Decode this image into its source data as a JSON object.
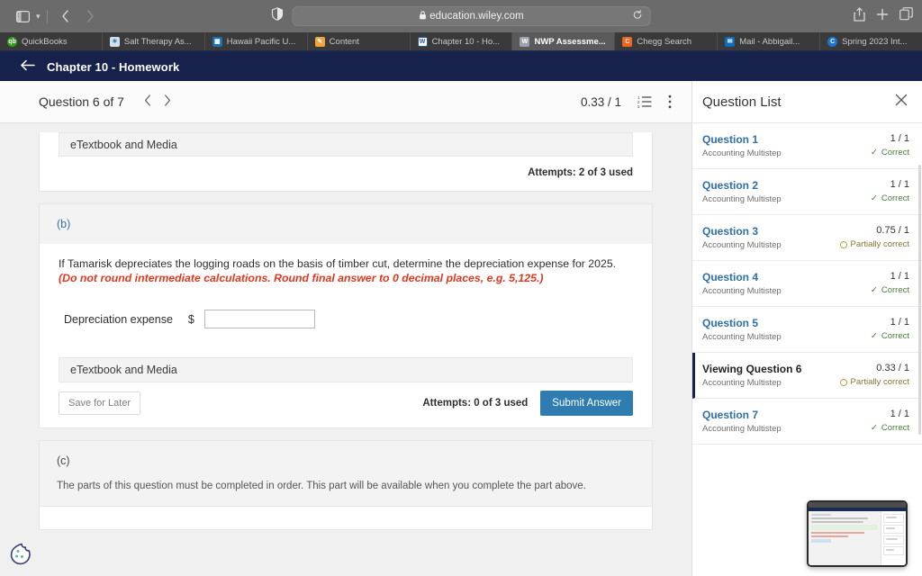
{
  "browser": {
    "url": "education.wiley.com",
    "lock_icon": "lock-icon",
    "reload_icon": "reload-icon",
    "shield_icon": "privacy-shield-icon",
    "sidebar_icon": "sidebar-toggle-icon",
    "back_icon": "back-arrow-icon",
    "forward_icon": "forward-arrow-icon",
    "share_icon": "share-icon",
    "newtab_icon": "plus-icon",
    "tabs_icon": "tab-overview-icon",
    "bookmarks": [
      {
        "label": "QuickBooks",
        "icon": "quickbooks-icon",
        "active": false
      },
      {
        "label": "Salt Therapy As...",
        "icon": "salt-therapy-icon",
        "active": false
      },
      {
        "label": "Hawaii Pacific U...",
        "icon": "hawaii-pacific-icon",
        "active": false
      },
      {
        "label": "Content",
        "icon": "content-icon",
        "active": false
      },
      {
        "label": "Chapter 10 - Ho...",
        "icon": "word-doc-icon",
        "active": false
      },
      {
        "label": "NWP Assessme...",
        "icon": "word-doc-icon",
        "active": true
      },
      {
        "label": "Chegg Search",
        "icon": "chegg-icon",
        "active": false
      },
      {
        "label": "Mail - Abbigail...",
        "icon": "outlook-icon",
        "active": false
      },
      {
        "label": "Spring 2023 Int...",
        "icon": "canvas-icon",
        "active": false
      }
    ]
  },
  "app": {
    "title": "Chapter 10 - Homework",
    "back_icon": "back-arrow-icon"
  },
  "question_header": {
    "position": "Question 6 of 7",
    "prev_icon": "chevron-left-icon",
    "next_icon": "chevron-right-icon",
    "score": "0.33 / 1",
    "list_icon": "numbered-list-icon",
    "menu_icon": "kebab-menu-icon"
  },
  "part_a": {
    "etextbook_label": "eTextbook and Media",
    "attempts": "Attempts: 2 of 3 used"
  },
  "part_b": {
    "label": "(b)",
    "question_text": "If Tamarisk depreciates the logging roads on the basis of timber cut, determine the depreciation expense for 2025.",
    "instruction_text": "(Do not round intermediate calculations. Round final answer to 0 decimal places, e.g. 5,125.)",
    "answer_label": "Depreciation expense",
    "currency_symbol": "$",
    "answer_value": "",
    "answer_placeholder": "",
    "etextbook_label": "eTextbook and Media",
    "save_for_later": "Save for Later",
    "attempts": "Attempts: 0 of 3 used",
    "submit_label": "Submit Answer",
    "submit_color": "#2e7cb0"
  },
  "part_c": {
    "label": "(c)",
    "text": "The parts of this question must be completed in order. This part will be available when you complete the part above."
  },
  "question_list": {
    "title": "Question List",
    "close_icon": "close-icon",
    "items": [
      {
        "name": "Question 1",
        "subtitle": "Accounting Multistep",
        "score": "1 / 1",
        "status": "Correct",
        "status_type": "correct",
        "current": false
      },
      {
        "name": "Question 2",
        "subtitle": "Accounting Multistep",
        "score": "1 / 1",
        "status": "Correct",
        "status_type": "correct",
        "current": false
      },
      {
        "name": "Question 3",
        "subtitle": "Accounting Multistep",
        "score": "0.75 / 1",
        "status": "Partially correct",
        "status_type": "partial",
        "current": false
      },
      {
        "name": "Question 4",
        "subtitle": "Accounting Multistep",
        "score": "1 / 1",
        "status": "Correct",
        "status_type": "correct",
        "current": false
      },
      {
        "name": "Question 5",
        "subtitle": "Accounting Multistep",
        "score": "1 / 1",
        "status": "Correct",
        "status_type": "correct",
        "current": false
      },
      {
        "name": "Viewing Question 6",
        "subtitle": "Accounting Multistep",
        "score": "0.33 / 1",
        "status": "Partially correct",
        "status_type": "partial",
        "current": true
      },
      {
        "name": "Question 7",
        "subtitle": "Accounting Multistep",
        "score": "1 / 1",
        "status": "Correct",
        "status_type": "correct",
        "current": false
      }
    ]
  },
  "overlays": {
    "cookie_icon": "cookie-consent-icon",
    "preview_thumbnail": "screen-preview-thumbnail"
  }
}
